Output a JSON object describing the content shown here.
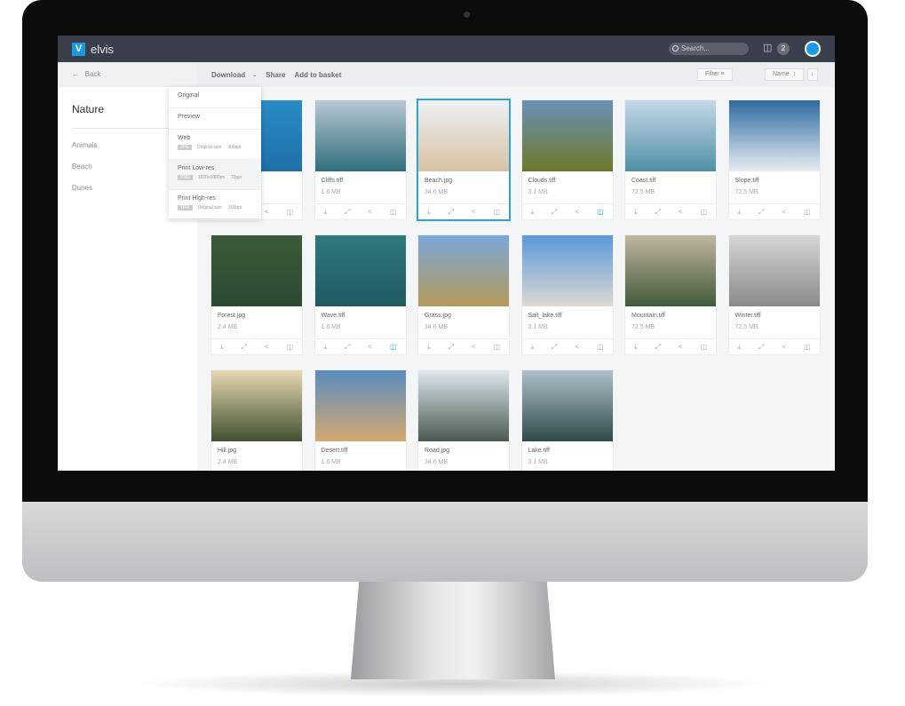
{
  "app": {
    "name": "elvis",
    "logo": "V"
  },
  "header": {
    "search_placeholder": "Search...",
    "basket_count": "2"
  },
  "toolbar": {
    "back": "Back",
    "download": "Download",
    "share": "Share",
    "add_to_basket": "Add to basket",
    "filter": "Filter",
    "sort": "Name"
  },
  "sidebar": {
    "title": "Nature",
    "items": [
      "Animals",
      "Beach",
      "Dunes"
    ]
  },
  "download_menu": [
    {
      "label": "Original"
    },
    {
      "label": "Preview"
    },
    {
      "label": "Web",
      "badge": "JPG",
      "size": "Original size",
      "res": "300ppi"
    },
    {
      "label": "Print Low-res",
      "badge": "PNG",
      "size": "1920x1080px",
      "res": "72ppi"
    },
    {
      "label": "Print High-res",
      "badge": "TIFF",
      "size": "Original size",
      "res": "300ppi"
    }
  ],
  "assets": [
    {
      "name": "",
      "size": ""
    },
    {
      "name": "Cliffs.tiff",
      "size": "1.8 MB"
    },
    {
      "name": "Beach.jpg",
      "size": "34.6 MB",
      "selected": true
    },
    {
      "name": "Clouds.tiff",
      "size": "3.1 MB",
      "in_basket": true
    },
    {
      "name": "Coast.tiff",
      "size": "72.5 MB"
    },
    {
      "name": "Slope.tiff",
      "size": "72.5 MB"
    },
    {
      "name": "Forest.jpg",
      "size": "2.4 MB"
    },
    {
      "name": "Wave.tiff",
      "size": "1.8 MB",
      "in_basket": true
    },
    {
      "name": "Grass.jpg",
      "size": "34.6 MB"
    },
    {
      "name": "Salt_lake.tiff",
      "size": "3.1 MB"
    },
    {
      "name": "Mountain.tiff",
      "size": "72.5 MB"
    },
    {
      "name": "Winter.tiff",
      "size": "72.5 MB"
    },
    {
      "name": "Hill.jpg",
      "size": "2.4 MB"
    },
    {
      "name": "Desert.tiff",
      "size": "1.8 MB"
    },
    {
      "name": "Road.jpg",
      "size": "34.6 MB"
    },
    {
      "name": "Lake.tiff",
      "size": "3.1 MB"
    }
  ],
  "colors": {
    "accent": "#1a9ae0",
    "header": "#3a3f4b"
  }
}
